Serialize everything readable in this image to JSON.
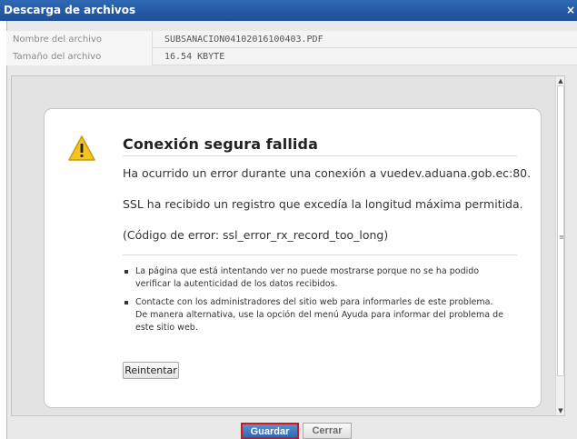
{
  "window": {
    "title": "Descarga de archivos",
    "close_glyph": "×"
  },
  "file": {
    "name_label": "Nombre del archivo",
    "name_value": "SUBSANACION04102016100403.PDF",
    "size_label": "Tamaño del archivo",
    "size_value": "16.54 KBYTE"
  },
  "error": {
    "icon": "warning-icon",
    "title": "Conexión segura fallida",
    "line1": "Ha ocurrido un error durante una conexión a vuedev.aduana.gob.ec:80.",
    "line2": "SSL ha recibido un registro que excedía la longitud máxima permitida.",
    "line3": "(Código de error: ssl_error_rx_record_too_long)",
    "bullets": [
      "La página que está intentando ver no puede mostrarse porque no se ha podido verificar la autenticidad de los datos recibidos.",
      "Contacte con los administradores del sitio web para informarles de este problema. De manera alternativa, use la opción del menú Ayuda para informar del problema de este sitio web."
    ],
    "retry_label": "Reintentar"
  },
  "scrollbar": {
    "up_glyph": "▲",
    "down_glyph": "▼",
    "grip_glyph": "≡"
  },
  "footer": {
    "save_label": "Guardar",
    "close_label": "Cerrar"
  },
  "colors": {
    "title_bar": "#2f69b4",
    "save_border": "#d2161d",
    "warning_fill": "#f2c51f"
  }
}
